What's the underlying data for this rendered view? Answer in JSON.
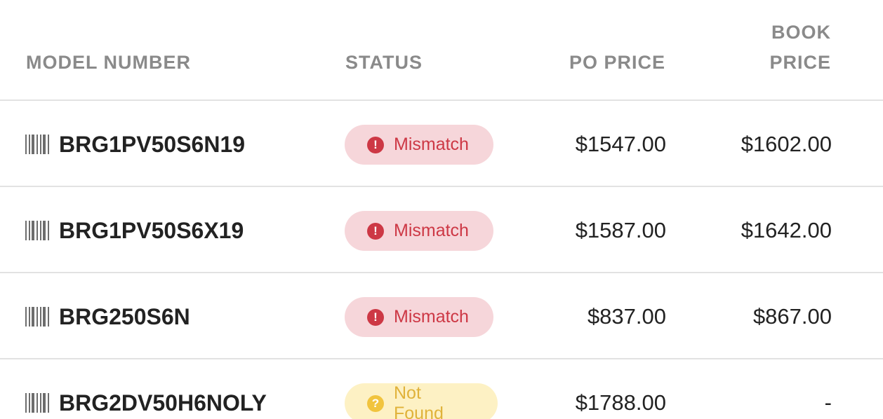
{
  "columns": {
    "model": "MODEL NUMBER",
    "status": "STATUS",
    "po_price": "PO PRICE",
    "book_price_line1": "BOOK",
    "book_price_line2": "PRICE"
  },
  "rows": [
    {
      "model": "BRG1PV50S6N19",
      "status": "Mismatch",
      "status_type": "mismatch",
      "po_price": "$1547.00",
      "book_price": "$1602.00"
    },
    {
      "model": "BRG1PV50S6X19",
      "status": "Mismatch",
      "status_type": "mismatch",
      "po_price": "$1587.00",
      "book_price": "$1642.00"
    },
    {
      "model": "BRG250S6N",
      "status": "Mismatch",
      "status_type": "mismatch",
      "po_price": "$837.00",
      "book_price": "$867.00"
    },
    {
      "model": "BRG2DV50H6NOLY",
      "status": "Not Found",
      "status_type": "notfound",
      "po_price": "$1788.00",
      "book_price": "-"
    }
  ],
  "icons": {
    "barcode": "barcode-icon",
    "mismatch": "exclamation-circle-icon",
    "notfound": "question-circle-icon"
  },
  "colors": {
    "mismatch_text": "#cd3845",
    "mismatch_bg": "#f6d6da",
    "notfound_text": "#e0b23a",
    "notfound_bg": "#fdf1c4"
  }
}
